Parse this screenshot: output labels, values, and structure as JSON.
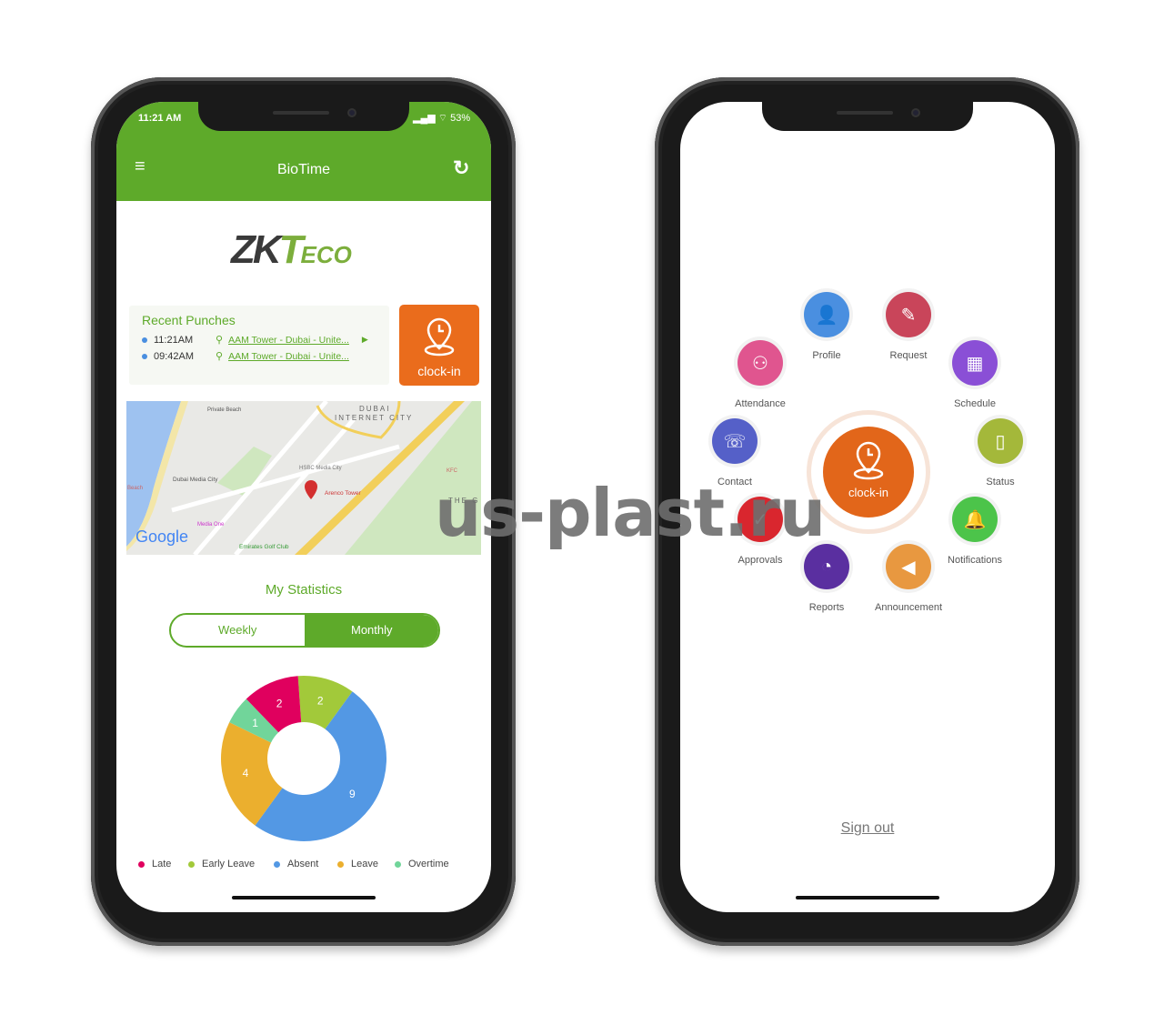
{
  "left_phone": {
    "status_bar": {
      "time": "11:21 AM",
      "battery": "53%"
    },
    "header": {
      "title": "BioTime",
      "menu_icon": "hamburger-icon",
      "refresh_icon": "refresh-icon"
    },
    "logo": "ZKTeco",
    "recent_punches": {
      "title": "Recent Punches",
      "items": [
        {
          "time": "11:21AM",
          "location": "AAM Tower - Dubai - Unite..."
        },
        {
          "time": "09:42AM",
          "location": "AAM Tower - Dubai - Unite..."
        }
      ]
    },
    "clock_in": {
      "label": "clock-in"
    },
    "map": {
      "labels": [
        "Private Beach",
        "DUBAI",
        "INTERNET CITY",
        "HSBC Media City",
        "Dubai Media City",
        "Beach",
        "Arenco Tower",
        "KFC",
        "Media One",
        "Emirates Golf Club",
        "THE G",
        "Google"
      ]
    },
    "stats": {
      "title": "My Statistics",
      "tabs": [
        {
          "label": "Weekly",
          "active": false
        },
        {
          "label": "Monthly",
          "active": true
        }
      ]
    },
    "accent": "#5eaa2a"
  },
  "chart_data": {
    "type": "pie",
    "donut": true,
    "categories": [
      "Late",
      "Early Leave",
      "Absent",
      "Leave",
      "Overtime"
    ],
    "values": [
      2,
      2,
      9,
      4,
      1
    ],
    "colors": [
      "#e0005e",
      "#a2c93a",
      "#5398e4",
      "#ebaf2e",
      "#71d59a"
    ],
    "legend": "bottom"
  },
  "right_phone": {
    "center": {
      "label": "clock-in",
      "color": "#e2661a"
    },
    "menu": [
      {
        "label": "Profile",
        "icon": "user-icon",
        "color": "#4a8fe0"
      },
      {
        "label": "Request",
        "icon": "document-edit-icon",
        "color": "#c9455a"
      },
      {
        "label": "Schedule",
        "icon": "calendar-icon",
        "color": "#8a4fd6"
      },
      {
        "label": "Status",
        "icon": "book-icon",
        "color": "#a4b83a"
      },
      {
        "label": "Notifications",
        "icon": "bell-icon",
        "color": "#4cc44a"
      },
      {
        "label": "Announcement",
        "icon": "speaker-icon",
        "color": "#e89840"
      },
      {
        "label": "Reports",
        "icon": "clock-user-icon",
        "color": "#5a2fa0"
      },
      {
        "label": "Approvals",
        "icon": "approve-icon",
        "color": "#d9262e"
      },
      {
        "label": "Contact",
        "icon": "address-book-icon",
        "color": "#5560c8"
      },
      {
        "label": "Attendance",
        "icon": "group-icon",
        "color": "#e0558f"
      }
    ],
    "sign_out": "Sign out"
  },
  "watermark": "us-plast.ru"
}
